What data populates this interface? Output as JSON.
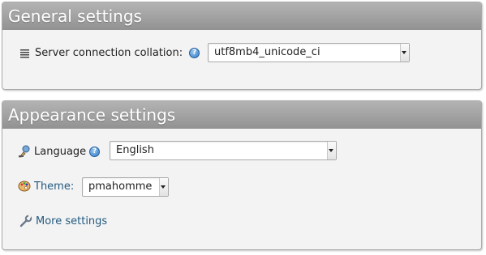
{
  "general": {
    "title": "General settings",
    "collation_label": "Server connection collation:",
    "collation_value": "utf8mb4_unicode_ci"
  },
  "appearance": {
    "title": "Appearance settings",
    "language_label": "Language",
    "language_value": "English",
    "theme_label": "Theme:",
    "theme_value": "pmahomme",
    "more_settings_label": "More settings"
  },
  "icons": {
    "collation": "collation-icon",
    "help": "help-icon",
    "language": "language-icon",
    "theme": "theme-palette-icon",
    "more_settings": "wrench-icon"
  },
  "colors": {
    "header_top": "#b3b3b3",
    "header_bottom": "#929292",
    "panel_bg": "#f3f3f3",
    "link": "#235a81"
  }
}
